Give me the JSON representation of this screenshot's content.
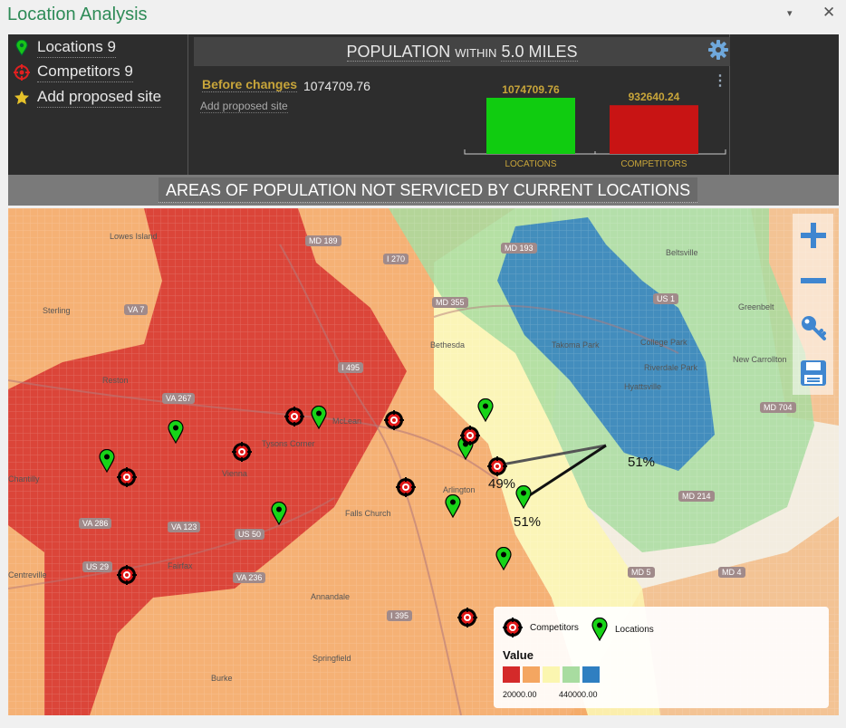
{
  "window": {
    "title": "Location Analysis",
    "dropdown_glyph": "▾",
    "close_glyph": "✕"
  },
  "layers": [
    {
      "icon": "green-pin-icon",
      "label": "Locations 9"
    },
    {
      "icon": "competitor-target-icon",
      "label": "Competitors 9"
    },
    {
      "icon": "star-icon",
      "label": "Add proposed site"
    }
  ],
  "population": {
    "title_a": "POPULATION",
    "title_b": "WITHIN",
    "title_c": "5.0 MILES",
    "before_label": "Before changes",
    "before_value": "1074709.76",
    "add_link": "Add proposed site"
  },
  "chart_data": {
    "type": "bar",
    "categories": [
      "LOCATIONS",
      "COMPETITORS"
    ],
    "values": [
      1074709.76,
      932640.24
    ],
    "value_labels": [
      "1074709.76",
      "932640.24"
    ],
    "colors": [
      "#10cc10",
      "#c81414"
    ],
    "grid": false
  },
  "section_title": "AREAS OF POPULATION NOT SERVICED BY CURRENT LOCATIONS",
  "map": {
    "places": [
      "Lowes Island",
      "Sterling",
      "Reston",
      "Tysons Corner",
      "McLean",
      "Vienna",
      "Bethesda",
      "Takoma Park",
      "College Park",
      "Riverdale Park",
      "Hyattsville",
      "Beltsville",
      "Greenbelt",
      "New Carrollton",
      "Falls Church",
      "Arlington",
      "Fairfax",
      "Chantilly",
      "Centreville",
      "Annandale",
      "Springfield",
      "Burke"
    ],
    "routes": [
      "MD 189",
      "I 270",
      "I 495",
      "VA 7",
      "VA 267",
      "VA 123",
      "VA 286",
      "US 29",
      "VA 236",
      "US 50",
      "I 395",
      "MD 193",
      "US 1",
      "MD 704",
      "MD 214",
      "MD 5",
      "MD 4",
      "MD 355"
    ],
    "labels": {
      "p49": "49%",
      "p51a": "51%",
      "p51b": "51%"
    }
  },
  "legend": {
    "competitors": "Competitors",
    "locations": "Locations",
    "value_title": "Value",
    "colors": [
      "#d42a2a",
      "#f4a661",
      "#fbf6b0",
      "#a8dca0",
      "#2f7fc1"
    ],
    "min": "20000.00",
    "max": "440000.00"
  },
  "tools": [
    "zoom-in-icon",
    "zoom-out-icon",
    "key-icon",
    "save-icon"
  ]
}
